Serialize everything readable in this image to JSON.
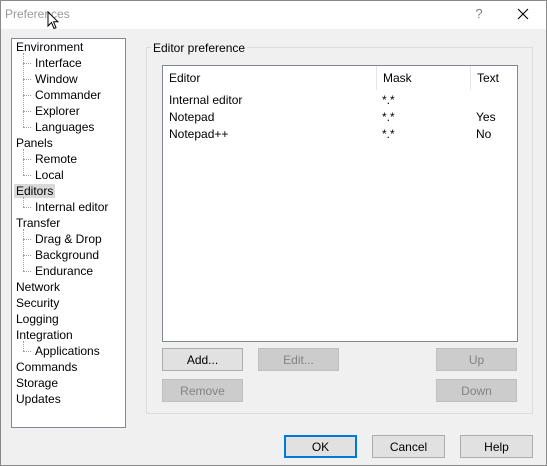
{
  "window": {
    "title": "Preferences",
    "help_glyph": "?",
    "close_glyph": "✕"
  },
  "tree": {
    "items": [
      {
        "label": "Environment",
        "level": 0
      },
      {
        "label": "Interface",
        "level": 1
      },
      {
        "label": "Window",
        "level": 1
      },
      {
        "label": "Commander",
        "level": 1
      },
      {
        "label": "Explorer",
        "level": 1
      },
      {
        "label": "Languages",
        "level": 1
      },
      {
        "label": "Panels",
        "level": 0
      },
      {
        "label": "Remote",
        "level": 1
      },
      {
        "label": "Local",
        "level": 1
      },
      {
        "label": "Editors",
        "level": 0,
        "selected": true
      },
      {
        "label": "Internal editor",
        "level": 1
      },
      {
        "label": "Transfer",
        "level": 0
      },
      {
        "label": "Drag & Drop",
        "level": 1
      },
      {
        "label": "Background",
        "level": 1
      },
      {
        "label": "Endurance",
        "level": 1
      },
      {
        "label": "Network",
        "level": 0
      },
      {
        "label": "Security",
        "level": 0
      },
      {
        "label": "Logging",
        "level": 0
      },
      {
        "label": "Integration",
        "level": 0
      },
      {
        "label": "Applications",
        "level": 1
      },
      {
        "label": "Commands",
        "level": 0
      },
      {
        "label": "Storage",
        "level": 0
      },
      {
        "label": "Updates",
        "level": 0
      }
    ]
  },
  "editor_pref": {
    "group_label": "Editor preference",
    "columns": [
      "Editor",
      "Mask",
      "Text"
    ],
    "rows": [
      [
        "Internal editor",
        "*.*",
        ""
      ],
      [
        "Notepad",
        "*.*",
        "Yes"
      ],
      [
        "Notepad++",
        "*.*",
        "No"
      ]
    ]
  },
  "buttons": {
    "add": "Add...",
    "edit": "Edit...",
    "up": "Up",
    "remove": "Remove",
    "down": "Down",
    "ok": "OK",
    "cancel": "Cancel",
    "help": "Help"
  },
  "colors": {
    "selection": "#d9d9d9",
    "accent": "#0078d7"
  }
}
